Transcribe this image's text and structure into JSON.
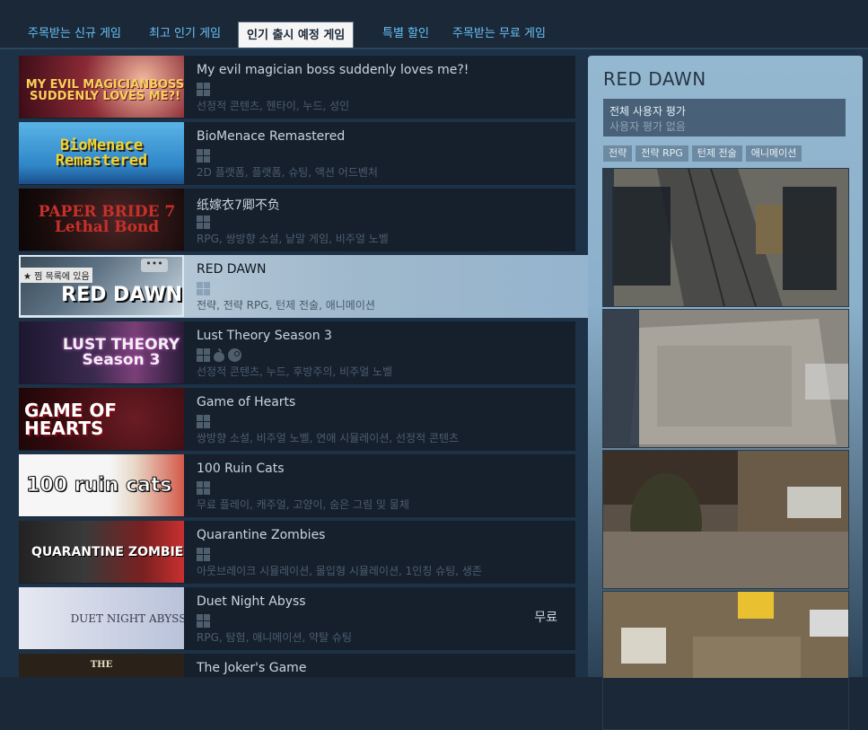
{
  "tabs": [
    {
      "label": "주목받는 신규 게임"
    },
    {
      "label": "최고 인기 게임"
    },
    {
      "label": "인기 출시 예정 게임"
    },
    {
      "label": "특별 할인"
    },
    {
      "label": "주목받는 무료 게임"
    }
  ],
  "games": [
    {
      "title": "My evil magician boss suddenly loves me?!",
      "tags": "선정적 콘텐츠, 헨타이, 누드, 성인",
      "platforms": [
        "windows-icon"
      ],
      "capsule_text": "MY EVIL MAGICIANBOSS SUDDENLY LOVES ME?!"
    },
    {
      "title": "BioMenace Remastered",
      "tags": "2D 플랫폼, 플랫폼, 슈팅, 액션 어드벤처",
      "platforms": [
        "windows-icon"
      ],
      "capsule_text": "BioMenace Remastered"
    },
    {
      "title": "纸嫁衣7卿不负",
      "tags": "RPG, 쌍방향 소설, 낱말 게임, 비주얼 노벨",
      "platforms": [
        "windows-icon"
      ],
      "capsule_text": "PAPER BRIDE 7 Lethal Bond"
    },
    {
      "title": "RED DAWN",
      "tags": "전략, 전략 RPG, 턴제 전술, 애니메이션",
      "platforms": [
        "windows-icon"
      ],
      "capsule_text": "RED DAWN",
      "more_label": "•••",
      "wishlist_label": "★ 찜 목록에 있음"
    },
    {
      "title": "Lust Theory Season 3",
      "tags": "선정적 콘텐츠, 누드, 후방주의, 비주얼 노벨",
      "platforms": [
        "windows-icon",
        "apple-icon",
        "steam-icon"
      ],
      "capsule_text": "LUST THEORY Season 3"
    },
    {
      "title": "Game of Hearts",
      "tags": "쌍방향 소설, 비주얼 노벨, 연애 시뮬레이션, 선정적 콘텐츠",
      "platforms": [
        "windows-icon"
      ],
      "capsule_text": "GAME OF HEARTS"
    },
    {
      "title": "100 Ruin Cats",
      "tags": "무료 플레이, 캐주얼, 고양이, 숨은 그림 및 물체",
      "platforms": [
        "windows-icon"
      ],
      "capsule_text": "100 ruin cats"
    },
    {
      "title": "Quarantine Zombies",
      "tags": "아웃브레이크 시뮬레이션, 몰입형 시뮬레이션, 1인칭 슈팅, 생존",
      "platforms": [
        "windows-icon"
      ],
      "capsule_text": "QUARANTINE ZOMBIES"
    },
    {
      "title": "Duet Night Abyss",
      "tags": "RPG, 탐험, 애니메이션, 약탈 슈팅",
      "platforms": [
        "windows-icon"
      ],
      "capsule_text": "DUET NIGHT ABYSS",
      "price": "무료"
    },
    {
      "title": "The Joker's Game",
      "tags": "",
      "platforms": [],
      "capsule_text": "THE"
    }
  ],
  "sidebar": {
    "title": "RED DAWN",
    "review_label": "전체 사용자 평가",
    "review_value": "사용자 평가 없음",
    "tags": [
      "전략",
      "전략 RPG",
      "턴제 전술",
      "애니메이션"
    ]
  },
  "colors": {
    "background": "#1b2838",
    "accent": "#67c1f5",
    "highlight": "#c6d4df"
  }
}
